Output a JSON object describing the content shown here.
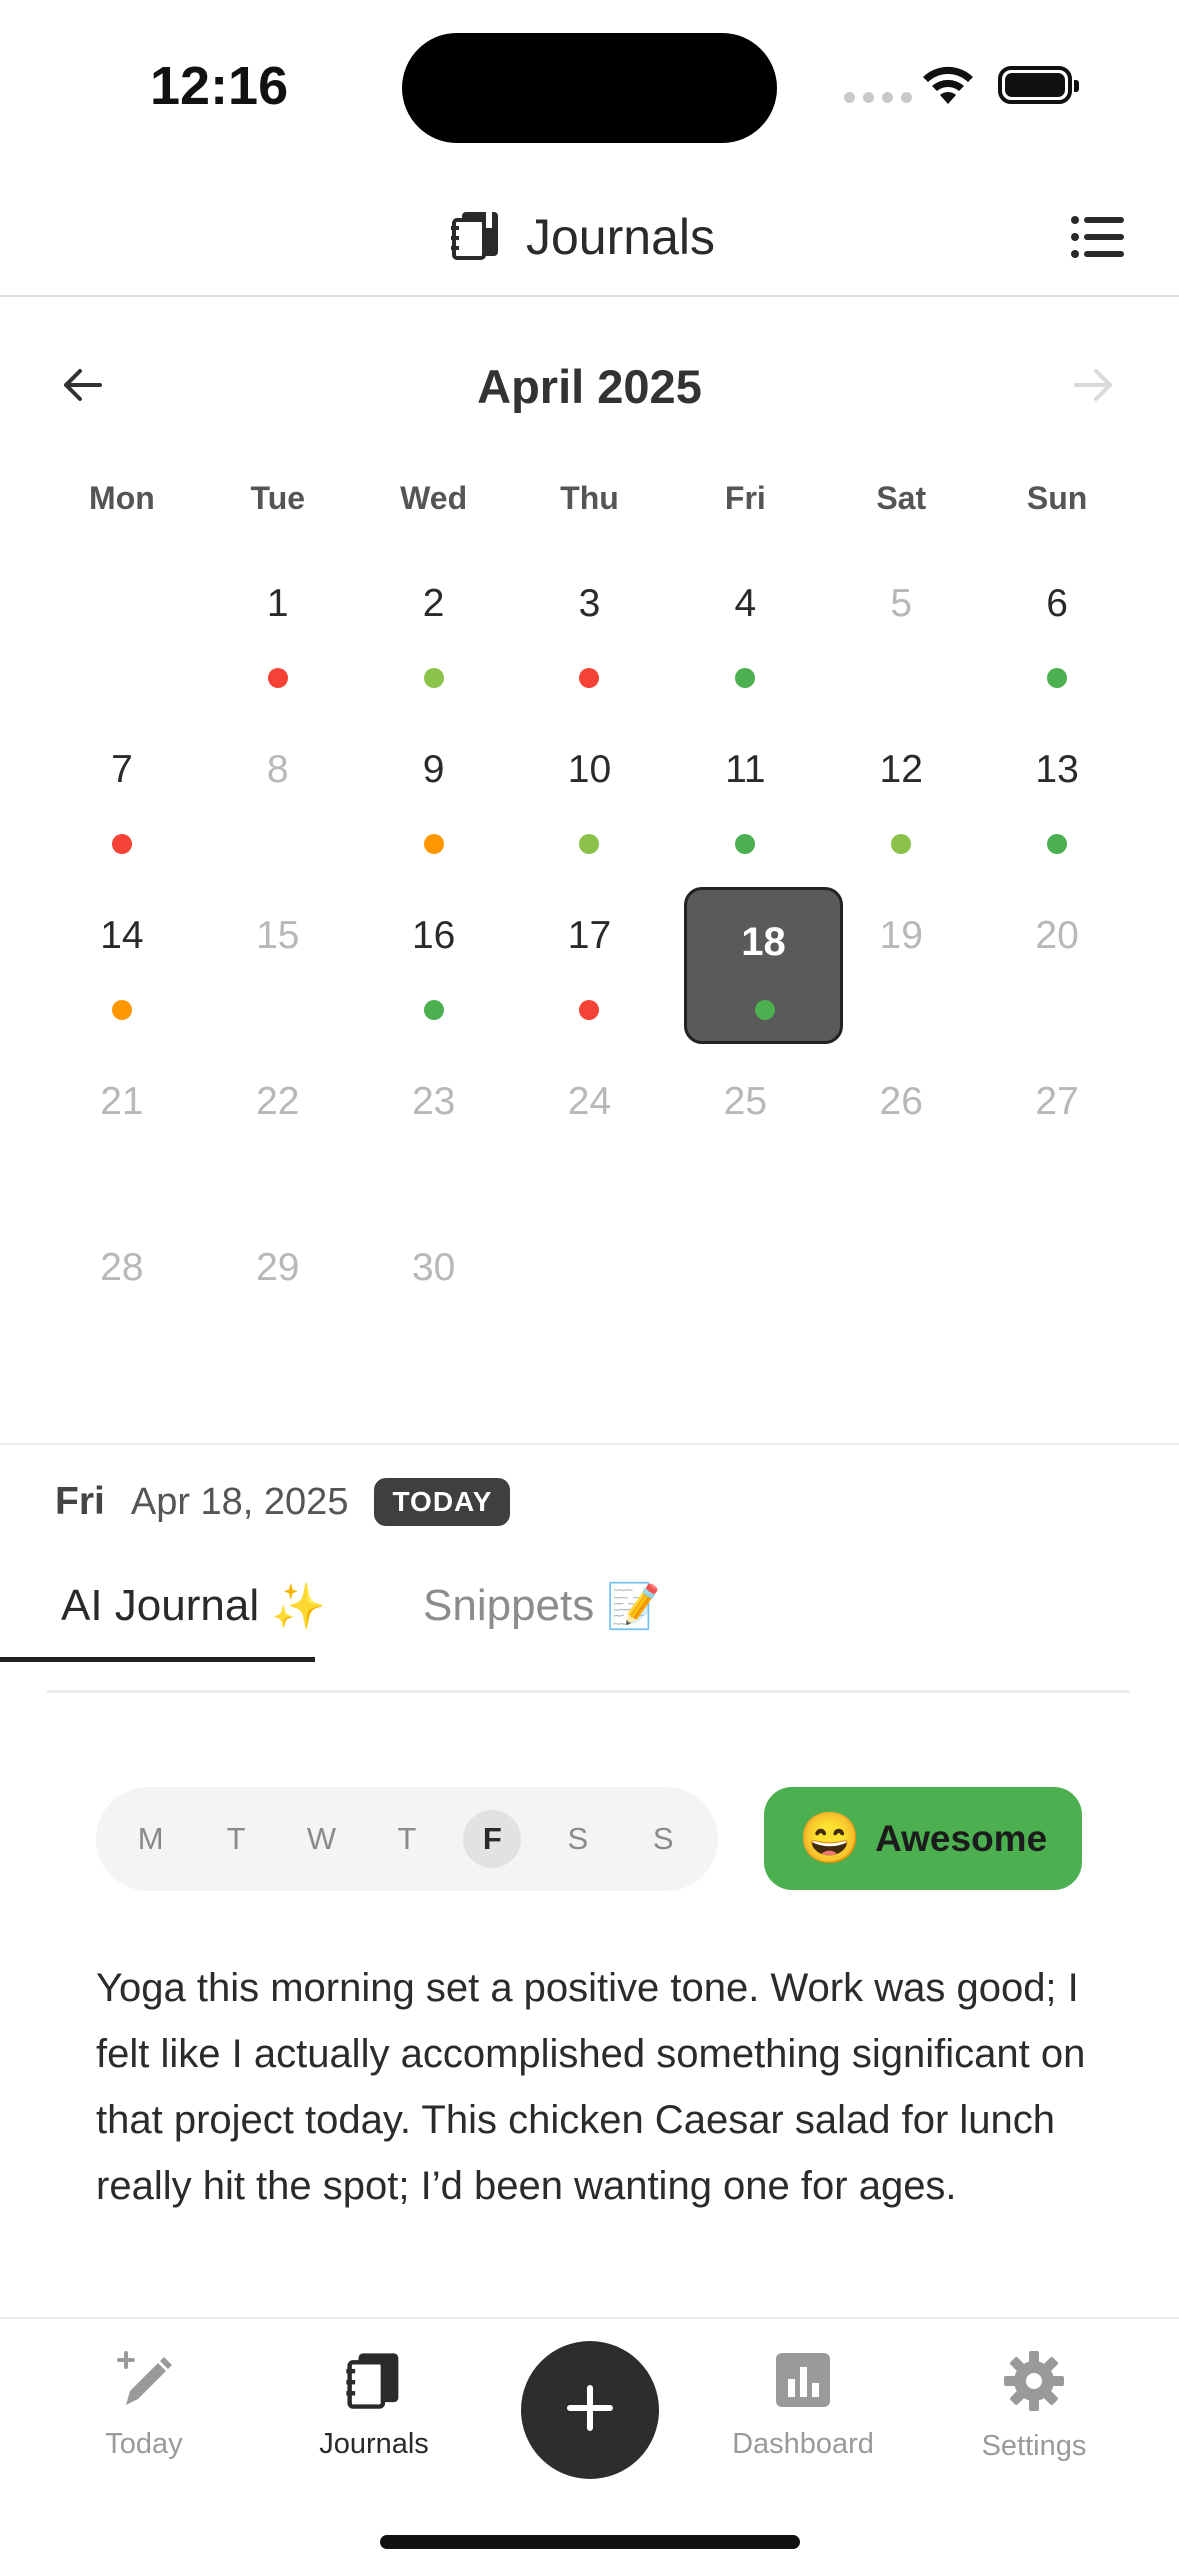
{
  "status_bar": {
    "time": "12:16"
  },
  "header": {
    "title": "Journals"
  },
  "calendar": {
    "month_title": "April 2025",
    "weekdays": [
      "Mon",
      "Tue",
      "Wed",
      "Thu",
      "Fri",
      "Sat",
      "Sun"
    ],
    "selected_day": "18",
    "selected_mood_color": "#4caf50",
    "days": [
      {
        "num": "",
        "mood": ""
      },
      {
        "num": "1",
        "mood": "#f44336"
      },
      {
        "num": "2",
        "mood": "#8bc34a"
      },
      {
        "num": "3",
        "mood": "#f44336"
      },
      {
        "num": "4",
        "mood": "#4caf50"
      },
      {
        "num": "5",
        "mood": "",
        "future": true
      },
      {
        "num": "6",
        "mood": "#4caf50"
      },
      {
        "num": "7",
        "mood": "#f44336"
      },
      {
        "num": "8",
        "mood": "",
        "future": true
      },
      {
        "num": "9",
        "mood": "#ff9800"
      },
      {
        "num": "10",
        "mood": "#8bc34a"
      },
      {
        "num": "11",
        "mood": "#4caf50"
      },
      {
        "num": "12",
        "mood": "#8bc34a"
      },
      {
        "num": "13",
        "mood": "#4caf50"
      },
      {
        "num": "14",
        "mood": "#ff9800"
      },
      {
        "num": "15",
        "mood": "",
        "future": true
      },
      {
        "num": "16",
        "mood": "#4caf50"
      },
      {
        "num": "17",
        "mood": "#f44336"
      },
      {
        "num": "18",
        "mood": "#4caf50",
        "selected": true
      },
      {
        "num": "19",
        "mood": "",
        "future": true
      },
      {
        "num": "20",
        "mood": "",
        "future": true
      },
      {
        "num": "21",
        "mood": "",
        "future": true
      },
      {
        "num": "22",
        "mood": "",
        "future": true
      },
      {
        "num": "23",
        "mood": "",
        "future": true
      },
      {
        "num": "24",
        "mood": "",
        "future": true
      },
      {
        "num": "25",
        "mood": "",
        "future": true
      },
      {
        "num": "26",
        "mood": "",
        "future": true
      },
      {
        "num": "27",
        "mood": "",
        "future": true
      },
      {
        "num": "28",
        "mood": "",
        "future": true
      },
      {
        "num": "29",
        "mood": "",
        "future": true
      },
      {
        "num": "30",
        "mood": "",
        "future": true
      }
    ]
  },
  "date_row": {
    "day": "Fri",
    "date": "Apr 18, 2025",
    "badge": "TODAY"
  },
  "tabs": {
    "ai_journal": "AI Journal",
    "ai_journal_emoji": "✨",
    "snippets": "Snippets",
    "snippets_emoji": "📝"
  },
  "week_strip": [
    "M",
    "T",
    "W",
    "T",
    "F",
    "S",
    "S"
  ],
  "week_active_index": 4,
  "mood": {
    "emoji": "😄",
    "label": "Awesome",
    "color": "#4caf50"
  },
  "entry_text": "Yoga this morning set a positive tone. Work was good; I felt like I actually accomplished something significant on that project today. This chicken Caesar salad for lunch really hit the spot; I’d been wanting one for ages.",
  "bottom_nav": {
    "today": "Today",
    "journals": "Journals",
    "dashboard": "Dashboard",
    "settings": "Settings"
  }
}
